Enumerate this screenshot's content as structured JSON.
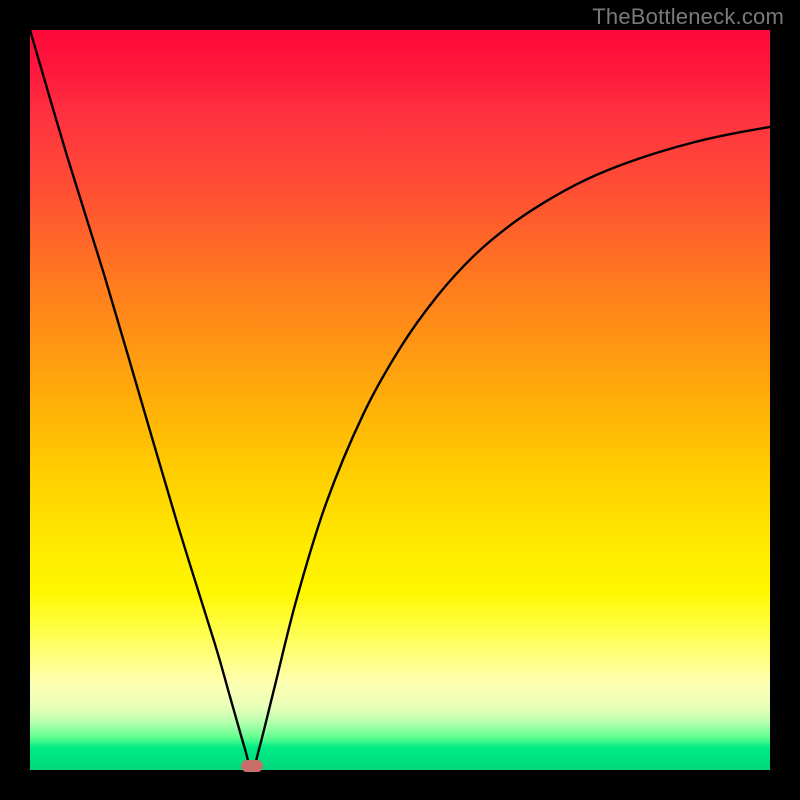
{
  "watermark": {
    "text": "TheBottleneck.com"
  },
  "chart_data": {
    "type": "line",
    "title": "",
    "xlabel": "",
    "ylabel": "",
    "xlim": [
      0,
      100
    ],
    "ylim": [
      0,
      100
    ],
    "series": [
      {
        "name": "curve",
        "x": [
          0,
          5,
          10,
          15,
          20,
          25,
          27,
          29,
          30,
          31,
          33,
          36,
          40,
          45,
          50,
          55,
          60,
          65,
          70,
          75,
          80,
          85,
          90,
          95,
          100
        ],
        "values": [
          100,
          83,
          67,
          50,
          33,
          17,
          10,
          3,
          0,
          3,
          11,
          23,
          36,
          48,
          57,
          64,
          69.5,
          73.7,
          77,
          79.7,
          81.8,
          83.5,
          84.9,
          86.0,
          86.9
        ]
      }
    ],
    "marker": {
      "x": 30,
      "y": 0,
      "color": "#c96f6a"
    },
    "gradient_colors": {
      "top": "#ff073a",
      "mid": "#ffe600",
      "bottom": "#00d87c"
    }
  }
}
